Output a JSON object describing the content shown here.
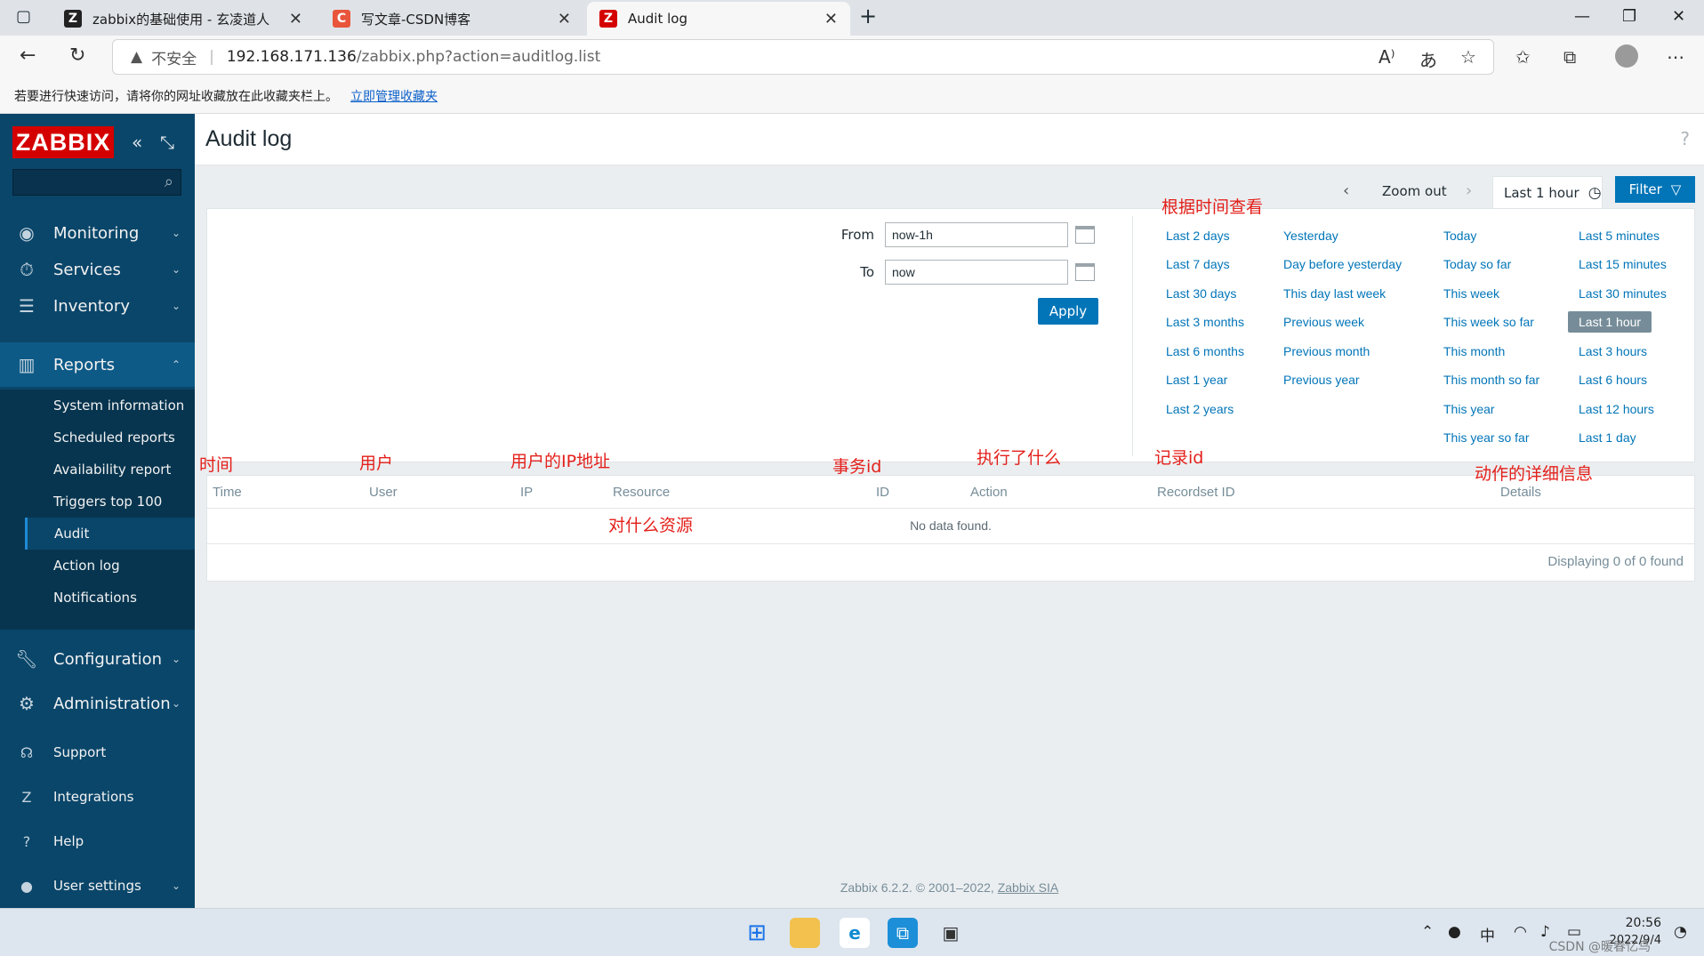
{
  "browser": {
    "tabs": [
      {
        "title": "zabbix的基础使用 - 玄凌道人",
        "favicon": "zabbix-blog-icon",
        "favicon_color": "#222222"
      },
      {
        "title": "写文章-CSDN博客",
        "favicon": "csdn-icon",
        "favicon_color": "#e8553b"
      },
      {
        "title": "Audit log",
        "favicon": "zabbix-icon",
        "favicon_color": "#d40000"
      }
    ],
    "insecure_label": "不安全",
    "url_host": "192.168.171.136",
    "url_path": "/zabbix.php?action=auditlog.list",
    "bookmark_hint": "若要进行快速访问，请将你的网址收藏放在此收藏夹栏上。",
    "bookmark_link": "立即管理收藏夹"
  },
  "sidebar": {
    "logo": "ZABBIX",
    "menu": [
      {
        "label": "Monitoring",
        "icon": "eye-icon"
      },
      {
        "label": "Services",
        "icon": "services-icon"
      },
      {
        "label": "Inventory",
        "icon": "list-icon"
      },
      {
        "label": "Reports",
        "icon": "reports-icon"
      },
      {
        "label": "Configuration",
        "icon": "wrench-icon"
      },
      {
        "label": "Administration",
        "icon": "gear-icon"
      }
    ],
    "reports_submenu": [
      "System information",
      "Scheduled reports",
      "Availability report",
      "Triggers top 100",
      "Audit",
      "Action log",
      "Notifications"
    ],
    "bottom": [
      {
        "label": "Support",
        "icon": "headset-icon"
      },
      {
        "label": "Integrations",
        "icon": "integrations-icon"
      },
      {
        "label": "Help",
        "icon": "question-icon"
      },
      {
        "label": "User settings",
        "icon": "user-icon"
      }
    ]
  },
  "main": {
    "title": "Audit log",
    "zoom_out": "Zoom out",
    "time_tab": "Last 1 hour",
    "filter_btn": "Filter",
    "from_label": "From",
    "from_value": "now-1h",
    "to_label": "To",
    "to_value": "now",
    "apply": "Apply",
    "quick_ranges": [
      [
        "Last 2 days",
        "Last 7 days",
        "Last 30 days",
        "Last 3 months",
        "Last 6 months",
        "Last 1 year",
        "Last 2 years"
      ],
      [
        "Yesterday",
        "Day before yesterday",
        "This day last week",
        "Previous week",
        "Previous month",
        "Previous year"
      ],
      [
        "Today",
        "Today so far",
        "This week",
        "This week so far",
        "This month",
        "This month so far",
        "This year",
        "This year so far"
      ],
      [
        "Last 5 minutes",
        "Last 15 minutes",
        "Last 30 minutes",
        "Last 1 hour",
        "Last 3 hours",
        "Last 6 hours",
        "Last 12 hours",
        "Last 1 day"
      ]
    ],
    "selected_range": "Last 1 hour",
    "table": {
      "columns": [
        "Time",
        "User",
        "IP",
        "Resource",
        "ID",
        "Action",
        "Recordset ID",
        "Details"
      ],
      "empty": "No data found.",
      "displaying": "Displaying 0 of 0 found"
    },
    "footer_text": "Zabbix 6.2.2. © 2001–2022, ",
    "footer_link": "Zabbix SIA"
  },
  "annotations": {
    "time_range": "根据时间查看",
    "time": "时间",
    "user": "用户",
    "ip": "用户的IP地址",
    "id": "事务id",
    "action": "执行了什么",
    "recordset": "记录id",
    "details": "动作的详细信息",
    "resource": "对什么资源"
  },
  "taskbar": {
    "ime": "中",
    "time": "20:56",
    "date": "2022/9/4",
    "watermark": "CSDN @暖春忆鸟"
  },
  "colors": {
    "sidebar_bg": "#0a466a",
    "accent": "#0275b8",
    "logo_red": "#d40000",
    "annotation_red": "#e3201b"
  }
}
